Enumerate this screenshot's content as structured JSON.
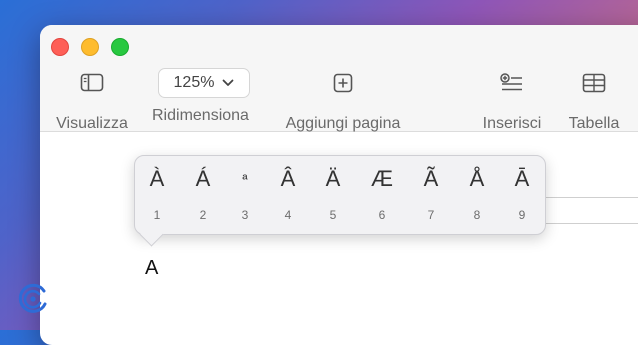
{
  "toolbar": {
    "view_label": "Visualizza",
    "zoom_value": "125%",
    "zoom_label": "Ridimensiona",
    "add_page_label": "Aggiungi pagina",
    "insert_label": "Inserisci",
    "table_label": "Tabella"
  },
  "accent_popover": {
    "characters": [
      {
        "glyph": "À",
        "number": "1"
      },
      {
        "glyph": "Á",
        "number": "2"
      },
      {
        "glyph": "ª",
        "number": "3"
      },
      {
        "glyph": "Â",
        "number": "4"
      },
      {
        "glyph": "Ä",
        "number": "5"
      },
      {
        "glyph": "Æ",
        "number": "6"
      },
      {
        "glyph": "Ã",
        "number": "7"
      },
      {
        "glyph": "Å",
        "number": "8"
      },
      {
        "glyph": "Ā",
        "number": "9"
      }
    ]
  },
  "document": {
    "typed_char": "A"
  },
  "colors": {
    "close": "#fe5f57",
    "minimize": "#febc2e",
    "maximize": "#28c840",
    "logo": "#2e6bd6"
  }
}
